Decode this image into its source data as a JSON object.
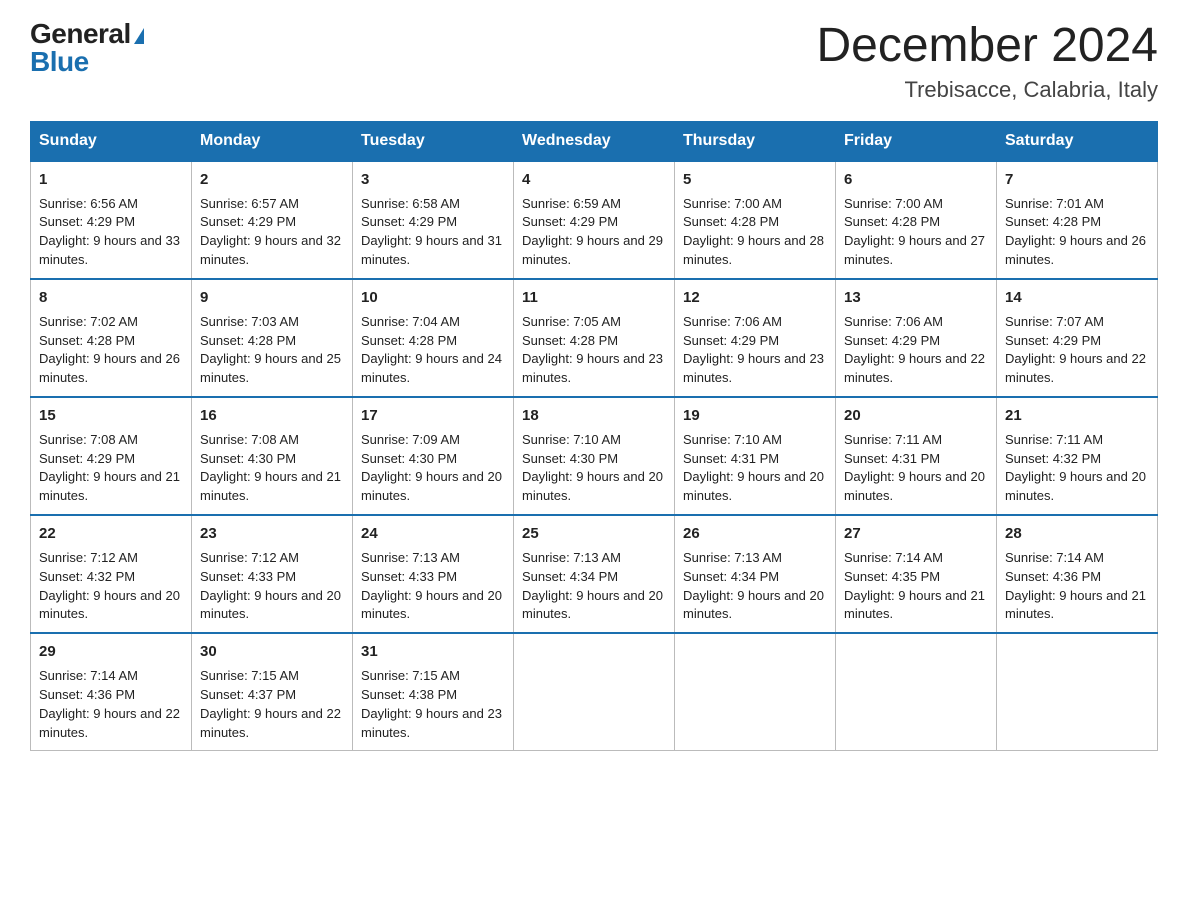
{
  "header": {
    "logo_general": "General",
    "logo_blue": "Blue",
    "month_year": "December 2024",
    "location": "Trebisacce, Calabria, Italy"
  },
  "days_of_week": [
    "Sunday",
    "Monday",
    "Tuesday",
    "Wednesday",
    "Thursday",
    "Friday",
    "Saturday"
  ],
  "weeks": [
    [
      {
        "day": "1",
        "sunrise": "6:56 AM",
        "sunset": "4:29 PM",
        "daylight": "9 hours and 33 minutes."
      },
      {
        "day": "2",
        "sunrise": "6:57 AM",
        "sunset": "4:29 PM",
        "daylight": "9 hours and 32 minutes."
      },
      {
        "day": "3",
        "sunrise": "6:58 AM",
        "sunset": "4:29 PM",
        "daylight": "9 hours and 31 minutes."
      },
      {
        "day": "4",
        "sunrise": "6:59 AM",
        "sunset": "4:29 PM",
        "daylight": "9 hours and 29 minutes."
      },
      {
        "day": "5",
        "sunrise": "7:00 AM",
        "sunset": "4:28 PM",
        "daylight": "9 hours and 28 minutes."
      },
      {
        "day": "6",
        "sunrise": "7:00 AM",
        "sunset": "4:28 PM",
        "daylight": "9 hours and 27 minutes."
      },
      {
        "day": "7",
        "sunrise": "7:01 AM",
        "sunset": "4:28 PM",
        "daylight": "9 hours and 26 minutes."
      }
    ],
    [
      {
        "day": "8",
        "sunrise": "7:02 AM",
        "sunset": "4:28 PM",
        "daylight": "9 hours and 26 minutes."
      },
      {
        "day": "9",
        "sunrise": "7:03 AM",
        "sunset": "4:28 PM",
        "daylight": "9 hours and 25 minutes."
      },
      {
        "day": "10",
        "sunrise": "7:04 AM",
        "sunset": "4:28 PM",
        "daylight": "9 hours and 24 minutes."
      },
      {
        "day": "11",
        "sunrise": "7:05 AM",
        "sunset": "4:28 PM",
        "daylight": "9 hours and 23 minutes."
      },
      {
        "day": "12",
        "sunrise": "7:06 AM",
        "sunset": "4:29 PM",
        "daylight": "9 hours and 23 minutes."
      },
      {
        "day": "13",
        "sunrise": "7:06 AM",
        "sunset": "4:29 PM",
        "daylight": "9 hours and 22 minutes."
      },
      {
        "day": "14",
        "sunrise": "7:07 AM",
        "sunset": "4:29 PM",
        "daylight": "9 hours and 22 minutes."
      }
    ],
    [
      {
        "day": "15",
        "sunrise": "7:08 AM",
        "sunset": "4:29 PM",
        "daylight": "9 hours and 21 minutes."
      },
      {
        "day": "16",
        "sunrise": "7:08 AM",
        "sunset": "4:30 PM",
        "daylight": "9 hours and 21 minutes."
      },
      {
        "day": "17",
        "sunrise": "7:09 AM",
        "sunset": "4:30 PM",
        "daylight": "9 hours and 20 minutes."
      },
      {
        "day": "18",
        "sunrise": "7:10 AM",
        "sunset": "4:30 PM",
        "daylight": "9 hours and 20 minutes."
      },
      {
        "day": "19",
        "sunrise": "7:10 AM",
        "sunset": "4:31 PM",
        "daylight": "9 hours and 20 minutes."
      },
      {
        "day": "20",
        "sunrise": "7:11 AM",
        "sunset": "4:31 PM",
        "daylight": "9 hours and 20 minutes."
      },
      {
        "day": "21",
        "sunrise": "7:11 AM",
        "sunset": "4:32 PM",
        "daylight": "9 hours and 20 minutes."
      }
    ],
    [
      {
        "day": "22",
        "sunrise": "7:12 AM",
        "sunset": "4:32 PM",
        "daylight": "9 hours and 20 minutes."
      },
      {
        "day": "23",
        "sunrise": "7:12 AM",
        "sunset": "4:33 PM",
        "daylight": "9 hours and 20 minutes."
      },
      {
        "day": "24",
        "sunrise": "7:13 AM",
        "sunset": "4:33 PM",
        "daylight": "9 hours and 20 minutes."
      },
      {
        "day": "25",
        "sunrise": "7:13 AM",
        "sunset": "4:34 PM",
        "daylight": "9 hours and 20 minutes."
      },
      {
        "day": "26",
        "sunrise": "7:13 AM",
        "sunset": "4:34 PM",
        "daylight": "9 hours and 20 minutes."
      },
      {
        "day": "27",
        "sunrise": "7:14 AM",
        "sunset": "4:35 PM",
        "daylight": "9 hours and 21 minutes."
      },
      {
        "day": "28",
        "sunrise": "7:14 AM",
        "sunset": "4:36 PM",
        "daylight": "9 hours and 21 minutes."
      }
    ],
    [
      {
        "day": "29",
        "sunrise": "7:14 AM",
        "sunset": "4:36 PM",
        "daylight": "9 hours and 22 minutes."
      },
      {
        "day": "30",
        "sunrise": "7:15 AM",
        "sunset": "4:37 PM",
        "daylight": "9 hours and 22 minutes."
      },
      {
        "day": "31",
        "sunrise": "7:15 AM",
        "sunset": "4:38 PM",
        "daylight": "9 hours and 23 minutes."
      },
      null,
      null,
      null,
      null
    ]
  ]
}
